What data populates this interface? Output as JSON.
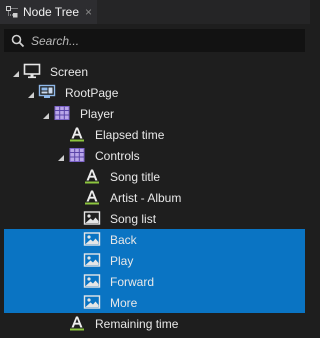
{
  "panel": {
    "tab_title": "Node Tree",
    "close_glyph": "×"
  },
  "search": {
    "placeholder": "Search...",
    "value": ""
  },
  "tree": {
    "nodes": [
      {
        "label": "Screen",
        "icon": "screen-icon",
        "depth": 0,
        "expanded": true,
        "has_children": true,
        "selected": false
      },
      {
        "label": "RootPage",
        "icon": "page-icon",
        "depth": 1,
        "expanded": true,
        "has_children": true,
        "selected": false
      },
      {
        "label": "Player",
        "icon": "grid-icon",
        "depth": 2,
        "expanded": true,
        "has_children": true,
        "selected": false
      },
      {
        "label": "Elapsed time",
        "icon": "text-block-icon",
        "depth": 3,
        "expanded": false,
        "has_children": false,
        "selected": false
      },
      {
        "label": "Controls",
        "icon": "grid-icon",
        "depth": 3,
        "expanded": true,
        "has_children": true,
        "selected": false
      },
      {
        "label": "Song title",
        "icon": "text-block-icon",
        "depth": 4,
        "expanded": false,
        "has_children": false,
        "selected": false
      },
      {
        "label": "Artist - Album",
        "icon": "text-block-icon",
        "depth": 4,
        "expanded": false,
        "has_children": false,
        "selected": false
      },
      {
        "label": "Song list",
        "icon": "image-icon",
        "depth": 4,
        "expanded": false,
        "has_children": false,
        "selected": false
      },
      {
        "label": "Back",
        "icon": "image-icon",
        "depth": 4,
        "expanded": false,
        "has_children": false,
        "selected": true
      },
      {
        "label": "Play",
        "icon": "image-icon",
        "depth": 4,
        "expanded": false,
        "has_children": false,
        "selected": true
      },
      {
        "label": "Forward",
        "icon": "image-icon",
        "depth": 4,
        "expanded": false,
        "has_children": false,
        "selected": true
      },
      {
        "label": "More",
        "icon": "image-icon",
        "depth": 4,
        "expanded": false,
        "has_children": false,
        "selected": true
      },
      {
        "label": "Remaining time",
        "icon": "text-block-icon",
        "depth": 3,
        "expanded": false,
        "has_children": false,
        "selected": false
      }
    ]
  },
  "colors": {
    "background": "#1e1e1e",
    "selection": "#0a74c3",
    "text_icon_green": "#8dc63f"
  }
}
